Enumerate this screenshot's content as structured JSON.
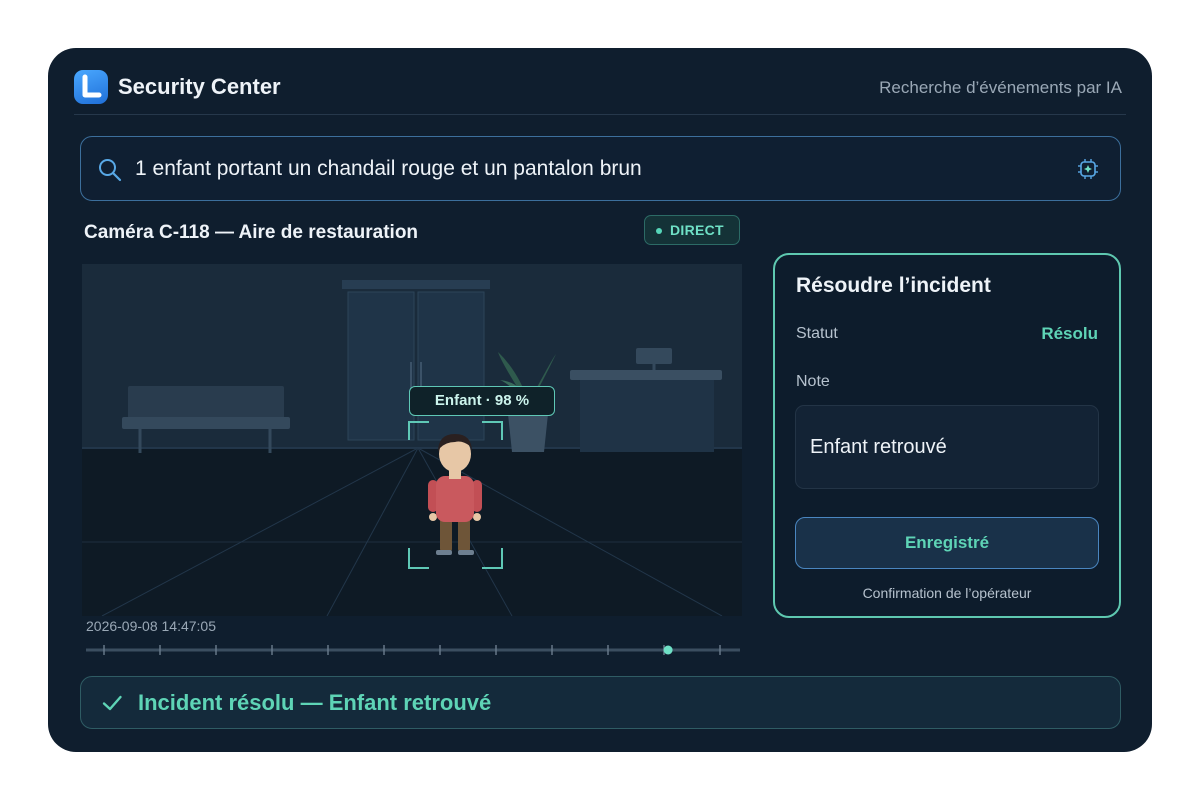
{
  "app": {
    "title": "Security Center",
    "subtitle": "Recherche d’événements par IA",
    "logo_icon": "app-logo-icon"
  },
  "search": {
    "query": "1 enfant portant un chandail rouge et un pantalon brun",
    "icon": "search-icon",
    "ai_icon": "ai-chip-icon"
  },
  "camera": {
    "title": "Caméra C-118 — Aire de restauration",
    "live_label": "DIRECT",
    "detection_label": "Enfant · 98 %",
    "timestamp": "2026-09-08 14:47:05",
    "playback_position": 0.89
  },
  "incident_panel": {
    "title": "Résoudre l’incident",
    "status_label": "Statut",
    "status_value": "Résolu",
    "note_label": "Note",
    "note_value": "Enfant retrouvé",
    "save_label": "Enregistré",
    "confirmation": "Confirmation de l’opérateur"
  },
  "toast": {
    "message": "Incident résolu — Enfant retrouvé",
    "icon": "check-icon"
  },
  "colors": {
    "background": "#0f1e2e",
    "accent": "#5ed4b6",
    "border_blue": "#3c6f9c"
  }
}
